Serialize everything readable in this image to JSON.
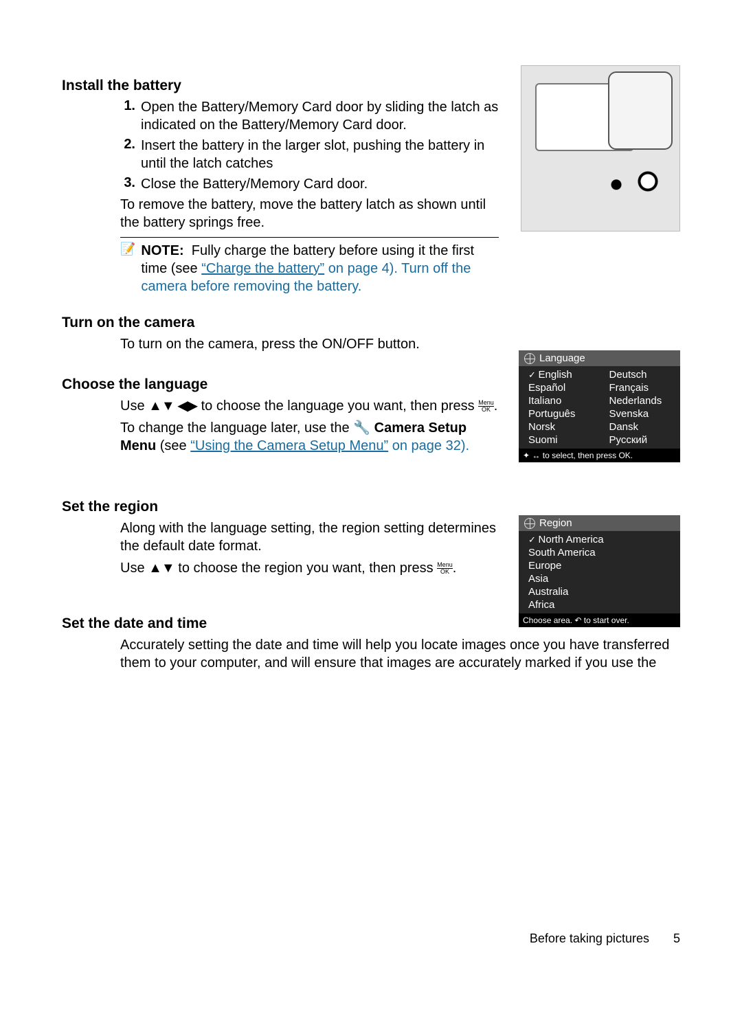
{
  "sections": {
    "install": {
      "heading": "Install the battery",
      "steps": [
        "Open the Battery/Memory Card door by sliding the latch as indicated on the Battery/Memory Card door.",
        "Insert the battery in the larger slot, pushing the battery in until the latch catches",
        "Close the Battery/Memory Card door."
      ],
      "remove": "To remove the battery, move the battery latch as shown until the battery springs free.",
      "note_label": "NOTE:",
      "note_before_link": "Fully charge the battery before using it the first time (see ",
      "note_link": "“Charge the battery”",
      "note_after_link": " on page 4). Turn off the camera before removing the battery."
    },
    "turn_on": {
      "heading": "Turn on the camera",
      "text_before": "To turn on the camera, press the ",
      "button": "ON/OFF",
      "text_after": " button."
    },
    "language": {
      "heading": "Choose the language",
      "p1_a": "Use ",
      "p1_b": " to choose the language you want, then press ",
      "p2_a": "To change the language later, use the ",
      "p2_b": "Camera Setup Menu",
      "p2_c": " (see ",
      "p2_link": "“Using the Camera Setup Menu”",
      "p2_d": " on page 32)."
    },
    "region": {
      "heading": "Set the region",
      "p1": "Along with the language setting, the region setting determines the default date format.",
      "p2_a": "Use ",
      "p2_b": " to choose the region you want, then press "
    },
    "datetime": {
      "heading": "Set the date and time",
      "p1": "Accurately setting the date and time will help you locate images once you have transferred them to your computer, and will ensure that images are accurately marked if you use the"
    }
  },
  "menu_labels": {
    "menu": "Menu",
    "ok": "OK"
  },
  "lang_menu": {
    "title": "Language",
    "col1": [
      "English",
      "Español",
      "Italiano",
      "Português",
      "Norsk",
      "Suomi"
    ],
    "col2": [
      "Deutsch",
      "Français",
      "Nederlands",
      "Svenska",
      "Dansk",
      "Русский"
    ],
    "foot_a": "to select, then press OK."
  },
  "region_menu": {
    "title": "Region",
    "items": [
      "North America",
      "South America",
      "Europe",
      "Asia",
      "Australia",
      "Africa"
    ],
    "foot_a": "Choose area.",
    "foot_b": "to start over."
  },
  "footer": {
    "text": "Before taking pictures",
    "page": "5"
  }
}
